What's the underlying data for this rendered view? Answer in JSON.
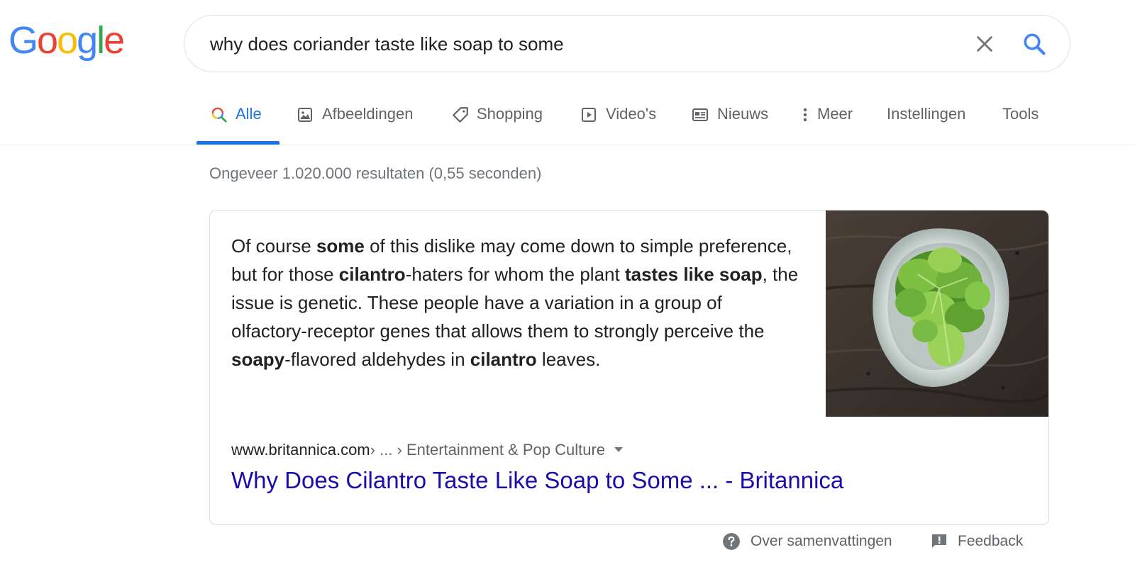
{
  "logo": {
    "letters": [
      "G",
      "o",
      "o",
      "g",
      "l",
      "e"
    ],
    "colors": [
      "#4285F4",
      "#EA4335",
      "#FBBC05",
      "#4285F4",
      "#34A853",
      "#EA4335"
    ]
  },
  "search": {
    "query": "why does coriander taste like soap to some"
  },
  "tabs": [
    {
      "label": "Alle",
      "icon": "search-multicolor-icon",
      "active": true
    },
    {
      "label": "Afbeeldingen",
      "icon": "image-icon"
    },
    {
      "label": "Shopping",
      "icon": "tag-icon"
    },
    {
      "label": "Video's",
      "icon": "play-icon"
    },
    {
      "label": "Nieuws",
      "icon": "newspaper-icon"
    },
    {
      "label": "Meer",
      "icon": "more-vert-icon"
    },
    {
      "label": "Instellingen"
    },
    {
      "label": "Tools"
    }
  ],
  "stats": "Ongeveer 1.020.000 resultaten (0,55 seconden)",
  "featured": {
    "snippet_parts": [
      {
        "text": "Of course ",
        "bold": false
      },
      {
        "text": "some",
        "bold": true
      },
      {
        "text": " of this dislike may come down to simple preference, but for those ",
        "bold": false
      },
      {
        "text": "cilantro",
        "bold": true
      },
      {
        "text": "-haters for whom the plant ",
        "bold": false
      },
      {
        "text": "tastes like soap",
        "bold": true
      },
      {
        "text": ", the issue is genetic. These people have a variation in a group of olfactory-receptor genes that allows them to strongly perceive the ",
        "bold": false
      },
      {
        "text": "soapy",
        "bold": true
      },
      {
        "text": "-flavored aldehydes in ",
        "bold": false
      },
      {
        "text": "cilantro",
        "bold": true
      },
      {
        "text": " leaves.",
        "bold": false
      }
    ],
    "image_alt": "bowl of cilantro",
    "breadcrumb_domain": "www.britannica.com",
    "breadcrumb_path": " › ... › Entertainment & Pop Culture",
    "title": "Why Does Cilantro Taste Like Soap to Some ... - Britannica"
  },
  "footer": {
    "about_label": "Over samenvattingen",
    "feedback_label": "Feedback"
  },
  "colors": {
    "accent": "#1a73e8",
    "link": "#1a0dab",
    "muted": "#5f6368"
  }
}
